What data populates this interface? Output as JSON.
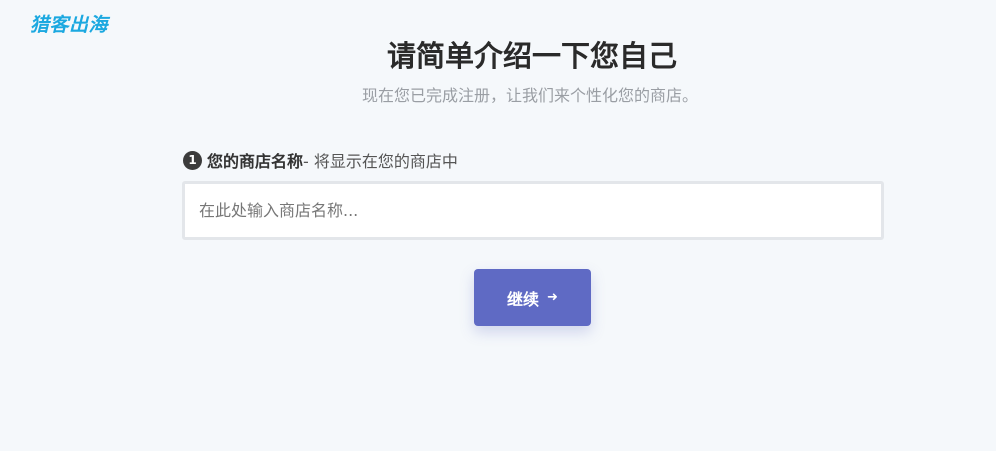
{
  "brand": {
    "logo_text": "猎客出海"
  },
  "header": {
    "title": "请简单介绍一下您自己",
    "subtitle": "现在您已完成注册，让我们来个性化您的商店。"
  },
  "form": {
    "step_number": "1",
    "field_label": "您的商店名称",
    "field_hint": "- 将显示在您的商店中",
    "store_name_value": "",
    "store_name_placeholder": "在此处输入商店名称..."
  },
  "actions": {
    "continue_label": "继续",
    "continue_icon": "arrow-right-icon"
  },
  "colors": {
    "accent": "#5f6ac4",
    "logo": "#1ba8e0",
    "background": "#f5f8fb"
  }
}
